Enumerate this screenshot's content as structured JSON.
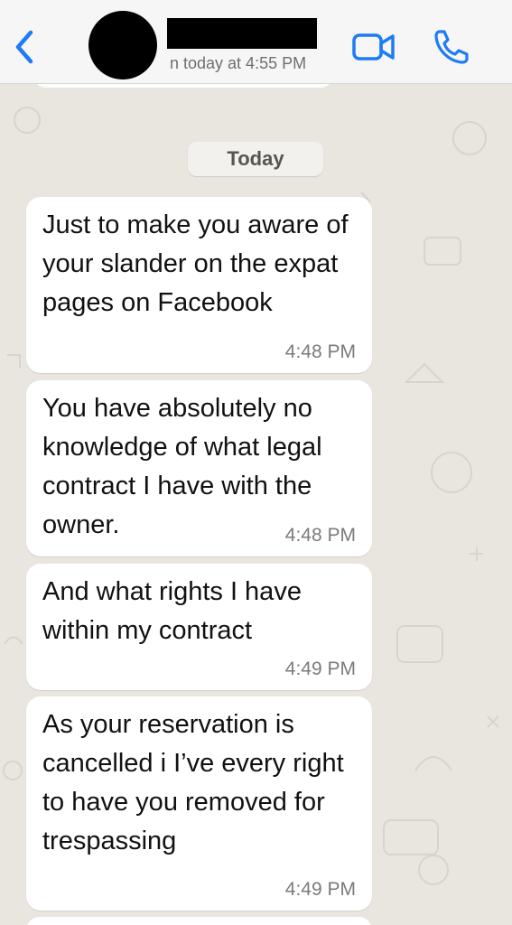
{
  "header": {
    "last_seen": "n today at 4:55 PM",
    "back_icon": "chevron-left-icon",
    "video_icon": "video-camera-icon",
    "call_icon": "phone-icon",
    "accent_color": "#1e7bf6"
  },
  "chat": {
    "date_label": "Today",
    "messages": [
      {
        "text": "Just to make you aware of your slander on the expat pages on Facebook",
        "time": "4:48 PM"
      },
      {
        "text": "You have absolutely no knowledge of what legal contract I have with the owner.",
        "time": "4:48 PM"
      },
      {
        "text": "And what rights I have within my contract",
        "time": "4:49 PM"
      },
      {
        "text": "As your reservation is cancelled i I’ve every right to have you removed for trespassing",
        "time": "4:49 PM"
      }
    ]
  }
}
